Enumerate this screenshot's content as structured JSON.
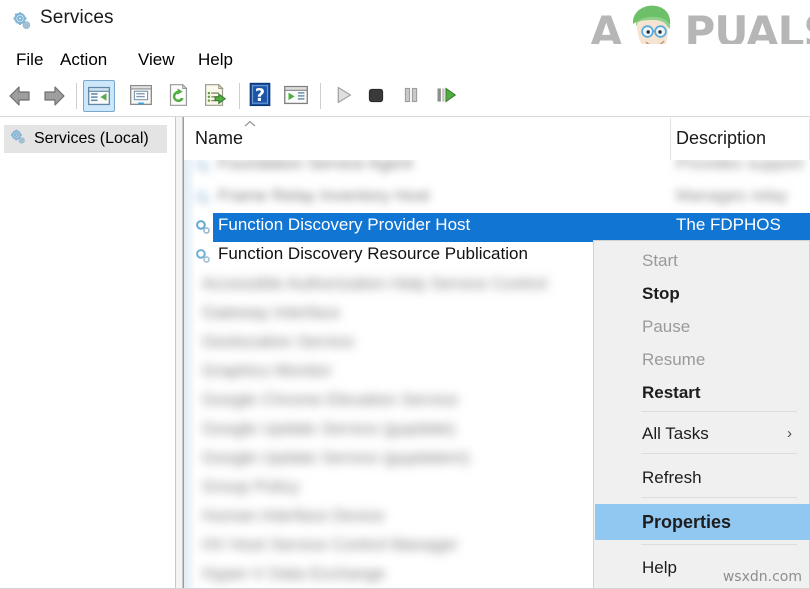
{
  "window": {
    "title": "Services",
    "icon": "services-gear-icon"
  },
  "branding": {
    "logo_text_left": "A",
    "logo_text_right": "PUALS",
    "logo_color": "#b6b6b6",
    "hair_color": "#6dc067",
    "skin_color": "#f3e0cf"
  },
  "menubar": {
    "items": [
      {
        "label": "File"
      },
      {
        "label": "Action"
      },
      {
        "label": "View"
      },
      {
        "label": "Help"
      }
    ]
  },
  "toolbar": {
    "buttons": [
      {
        "name": "back-icon",
        "label": "Back",
        "enabled": true,
        "pressed": false
      },
      {
        "name": "forward-icon",
        "label": "Forward",
        "enabled": true,
        "pressed": false
      },
      {
        "name": "show-hide-tree-icon",
        "label": "Show/Hide Console Tree",
        "enabled": true,
        "pressed": true
      },
      {
        "name": "properties-icon",
        "label": "Properties",
        "enabled": true,
        "pressed": false
      },
      {
        "name": "refresh-icon",
        "label": "Refresh",
        "enabled": true,
        "pressed": false
      },
      {
        "name": "export-list-icon",
        "label": "Export List",
        "enabled": true,
        "pressed": false
      },
      {
        "name": "help-icon",
        "label": "Help",
        "enabled": true,
        "pressed": false
      },
      {
        "name": "show-action-pane-icon",
        "label": "Show/Hide Action Pane",
        "enabled": true,
        "pressed": false
      },
      {
        "name": "start-service-icon",
        "label": "Start Service",
        "enabled": false,
        "pressed": false
      },
      {
        "name": "stop-service-icon",
        "label": "Stop Service",
        "enabled": true,
        "pressed": false
      },
      {
        "name": "pause-service-icon",
        "label": "Pause Service",
        "enabled": false,
        "pressed": false
      },
      {
        "name": "restart-service-icon",
        "label": "Restart Service",
        "enabled": true,
        "pressed": false
      }
    ]
  },
  "sidebar": {
    "items": [
      {
        "label": "Services (Local)",
        "icon": "services-gear-icon",
        "selected": true
      }
    ]
  },
  "list": {
    "columns": [
      {
        "label": "Name",
        "sorted": "ascending"
      },
      {
        "label": "Description"
      }
    ],
    "rows": [
      {
        "name": "",
        "description": "",
        "blurred": true,
        "selected": false
      },
      {
        "name": "",
        "description": "",
        "blurred": true,
        "selected": false
      },
      {
        "name": "Function Discovery Provider Host",
        "description": "The FDPHOS",
        "blurred": false,
        "selected": true
      },
      {
        "name": "Function Discovery Resource Publication",
        "description": "",
        "blurred": false,
        "selected": false
      },
      {
        "name": "",
        "description": "",
        "blurred": true,
        "selected": false
      },
      {
        "name": "",
        "description": "",
        "blurred": true,
        "selected": false
      },
      {
        "name": "",
        "description": "",
        "blurred": true,
        "selected": false
      },
      {
        "name": "",
        "description": "",
        "blurred": true,
        "selected": false
      },
      {
        "name": "",
        "description": "",
        "blurred": true,
        "selected": false
      },
      {
        "name": "",
        "description": "",
        "blurred": true,
        "selected": false
      },
      {
        "name": "",
        "description": "",
        "blurred": true,
        "selected": false
      },
      {
        "name": "",
        "description": "",
        "blurred": true,
        "selected": false
      },
      {
        "name": "",
        "description": "",
        "blurred": true,
        "selected": false
      },
      {
        "name": "",
        "description": "",
        "blurred": true,
        "selected": false
      }
    ]
  },
  "context_menu": {
    "items": [
      {
        "label": "Start",
        "enabled": false,
        "highlighted": false,
        "submenu": false,
        "separator_after": false
      },
      {
        "label": "Stop",
        "enabled": true,
        "highlighted": false,
        "submenu": false,
        "separator_after": false
      },
      {
        "label": "Pause",
        "enabled": false,
        "highlighted": false,
        "submenu": false,
        "separator_after": false
      },
      {
        "label": "Resume",
        "enabled": false,
        "highlighted": false,
        "submenu": false,
        "separator_after": false
      },
      {
        "label": "Restart",
        "enabled": true,
        "highlighted": false,
        "submenu": false,
        "separator_after": true
      },
      {
        "label": "All Tasks",
        "enabled": true,
        "highlighted": false,
        "submenu": true,
        "separator_after": true
      },
      {
        "label": "Refresh",
        "enabled": true,
        "highlighted": false,
        "submenu": false,
        "separator_after": true
      },
      {
        "label": "Properties",
        "enabled": true,
        "highlighted": true,
        "submenu": false,
        "separator_after": true
      },
      {
        "label": "Help",
        "enabled": true,
        "highlighted": false,
        "submenu": false,
        "separator_after": false
      }
    ],
    "submenu_arrow": "›",
    "highlight_color": "#91c8f2"
  },
  "watermark": {
    "text": "wsxdn.com"
  }
}
